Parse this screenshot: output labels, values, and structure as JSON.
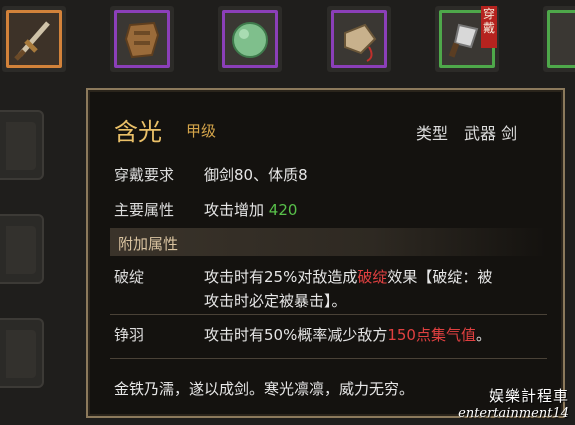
{
  "inventory": {
    "slots": [
      {
        "name": "sword",
        "frame_color": "#d2823a",
        "icon": "sword-icon"
      },
      {
        "name": "armor",
        "frame_color": "#8b3fb8",
        "icon": "armor-icon"
      },
      {
        "name": "jade",
        "frame_color": "#8b3fb8",
        "icon": "jade-stone-icon"
      },
      {
        "name": "pendant",
        "frame_color": "#8b3fb8",
        "icon": "pendant-icon"
      },
      {
        "name": "cleaver",
        "frame_color": "#4ea84a",
        "icon": "cleaver-icon",
        "tag": "穿戴"
      }
    ]
  },
  "tooltip": {
    "name": "含光",
    "grade": "甲级",
    "type_label": "类型",
    "type_value": "武器 剑",
    "requirement_label": "穿戴要求",
    "requirement_value": "御剑80、体质8",
    "main_attr_label": "主要属性",
    "main_attr_text": "攻击增加",
    "main_attr_value": "420",
    "extra_section": "附加属性",
    "effects": [
      {
        "name": "破绽",
        "line1_a": "攻击时有25%对敌造成",
        "line1_b": "破绽",
        "line1_c": "效果【破绽：被",
        "line2": "攻击时必定被暴击】。"
      },
      {
        "name": "铮羽",
        "line1_a": "攻击时有50%概率减少敌方",
        "line1_b": "150点集气值",
        "line1_c": "。"
      }
    ],
    "flavor": "金铁乃濡，遂以成剑。寒光凛凛，威力无穷。"
  },
  "watermark": {
    "line1": "娱樂計程車",
    "line2": "entertainment14"
  },
  "colors": {
    "rarity_orange": "#d2823a",
    "rarity_purple": "#8b3fb8",
    "rarity_green": "#4ea84a",
    "name_gold": "#eac068",
    "value_green": "#58c04a",
    "highlight_red": "#e04040"
  }
}
